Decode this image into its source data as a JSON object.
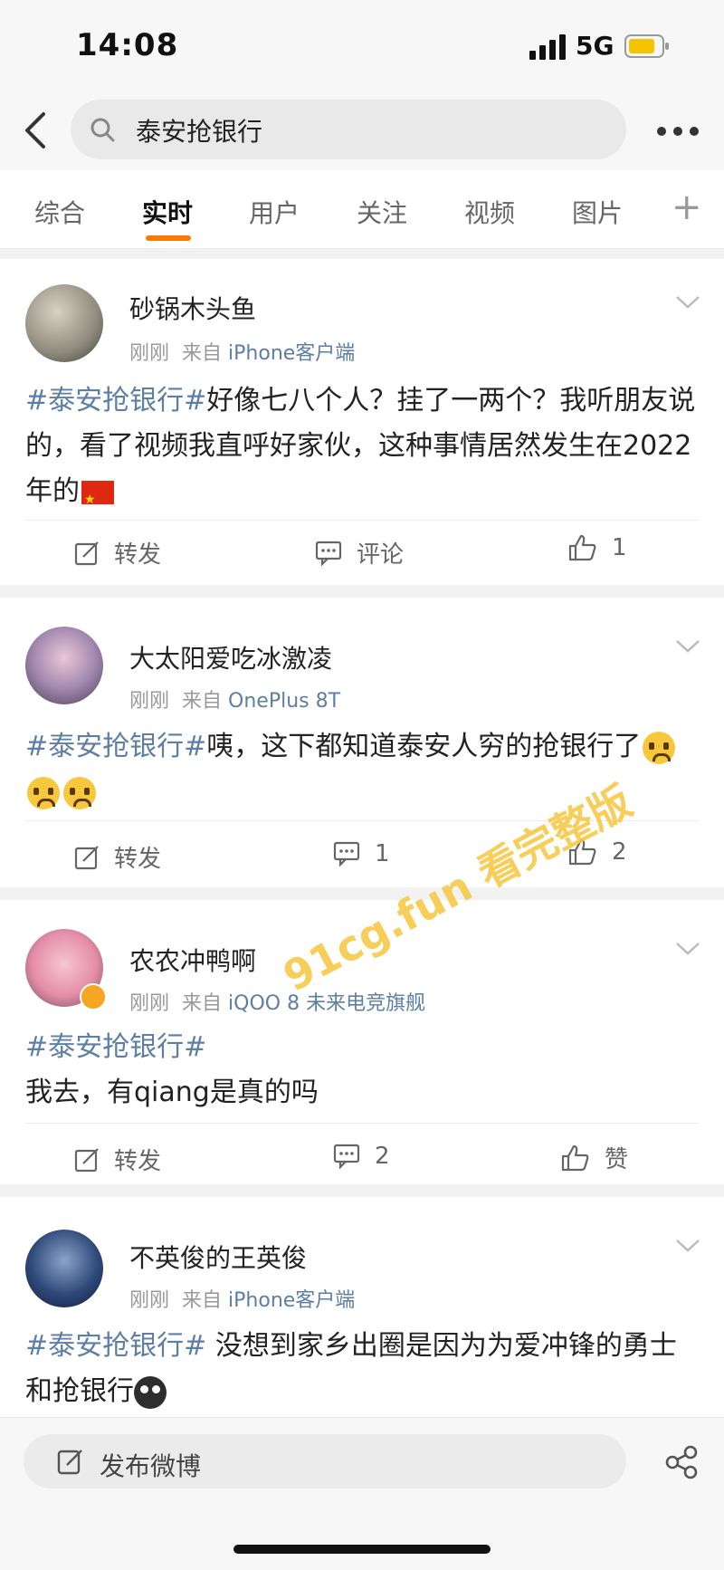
{
  "status": {
    "time": "14:08",
    "network": "5G"
  },
  "search": {
    "query": "泰安抢银行"
  },
  "tabs": [
    {
      "label": "综合"
    },
    {
      "label": "实时"
    },
    {
      "label": "用户"
    },
    {
      "label": "关注"
    },
    {
      "label": "视频"
    },
    {
      "label": "图片"
    }
  ],
  "tabs_add": "+",
  "posts": [
    {
      "user": "砂锅木头鱼",
      "time": "刚刚",
      "from": "来自",
      "source": "iPhone客户端",
      "tag": "#泰安抢银行#",
      "text": "好像七八个人？挂了一两个？我听朋友说的，看了视频我直呼好家伙，这种事情居然发生在2022年的",
      "repost": "转发",
      "comment": "评论",
      "like": "1"
    },
    {
      "user": "大太阳爱吃冰激凌",
      "time": "刚刚",
      "from": "来自",
      "source": "OnePlus 8T",
      "tag": "#泰安抢银行#",
      "text": "咦，这下都知道泰安人穷的抢银行了",
      "repost": "转发",
      "comment": "1",
      "like": "2"
    },
    {
      "user": "农农冲鸭啊",
      "time": "刚刚",
      "from": "来自",
      "source": "iQOO 8 未来电竞旗舰",
      "tag": "#泰安抢银行#",
      "text": "我去，有qiang是真的吗",
      "repost": "转发",
      "comment": "2",
      "like": "赞"
    },
    {
      "user": "不英俊的王英俊",
      "time": "刚刚",
      "from": "来自",
      "source": "iPhone客户端",
      "tag": "#泰安抢银行#",
      "text": " 没想到家乡出圈是因为为爱冲锋的勇士和抢银行"
    }
  ],
  "watermark": "91cg.fun 看完整版",
  "compose": {
    "placeholder": "发布微博"
  },
  "colors": {
    "accent": "#ff7a00",
    "link": "#5d7ea5"
  }
}
